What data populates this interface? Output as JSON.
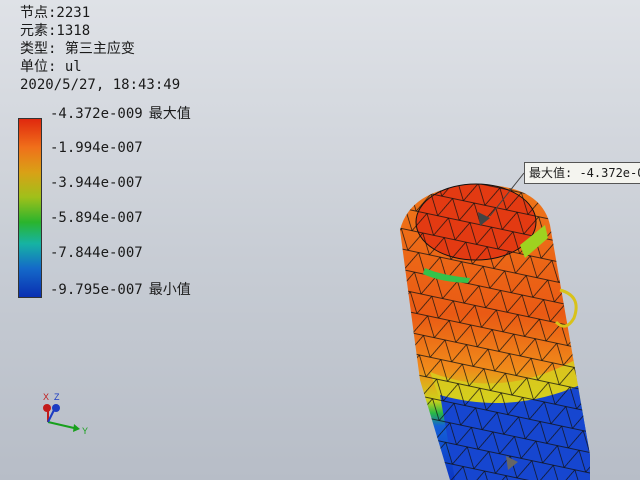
{
  "info": {
    "nodes": "节点:2231",
    "elements": "元素:1318",
    "type": "类型: 第三主应变",
    "unit": "单位: ul",
    "timestamp": "2020/5/27, 18:43:49"
  },
  "legend": {
    "values": [
      "-4.372e-009",
      "-1.994e-007",
      "-3.944e-007",
      "-5.894e-007",
      "-7.844e-007",
      "-9.795e-007"
    ],
    "max_tag": "最大值",
    "min_tag": "最小值",
    "colors": [
      "#e0280e",
      "#f0701a",
      "#d9a116",
      "#2ab42d",
      "#16b3a3",
      "#0a2fb1"
    ]
  },
  "callout": {
    "text": "最大值: -4.372e-0"
  },
  "triad": {
    "x": "X",
    "y": "Y",
    "z": "Z"
  }
}
